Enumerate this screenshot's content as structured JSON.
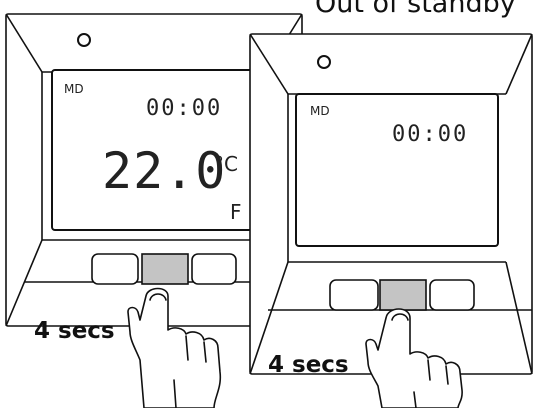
{
  "captions": {
    "top_right": "Out of standby",
    "left": "4 secs",
    "right": "4 secs"
  },
  "left_thermostat": {
    "mode": "MD",
    "time": "00:00",
    "temperature": "22.0",
    "unit": "°C",
    "flag": "F",
    "power_symbol": "O"
  },
  "right_thermostat": {
    "mode": "MD",
    "time": "00:00",
    "power_symbol": "O"
  },
  "colors": {
    "outline": "#111111",
    "pressed_button": "#c4c4c4",
    "background": "#ffffff"
  }
}
